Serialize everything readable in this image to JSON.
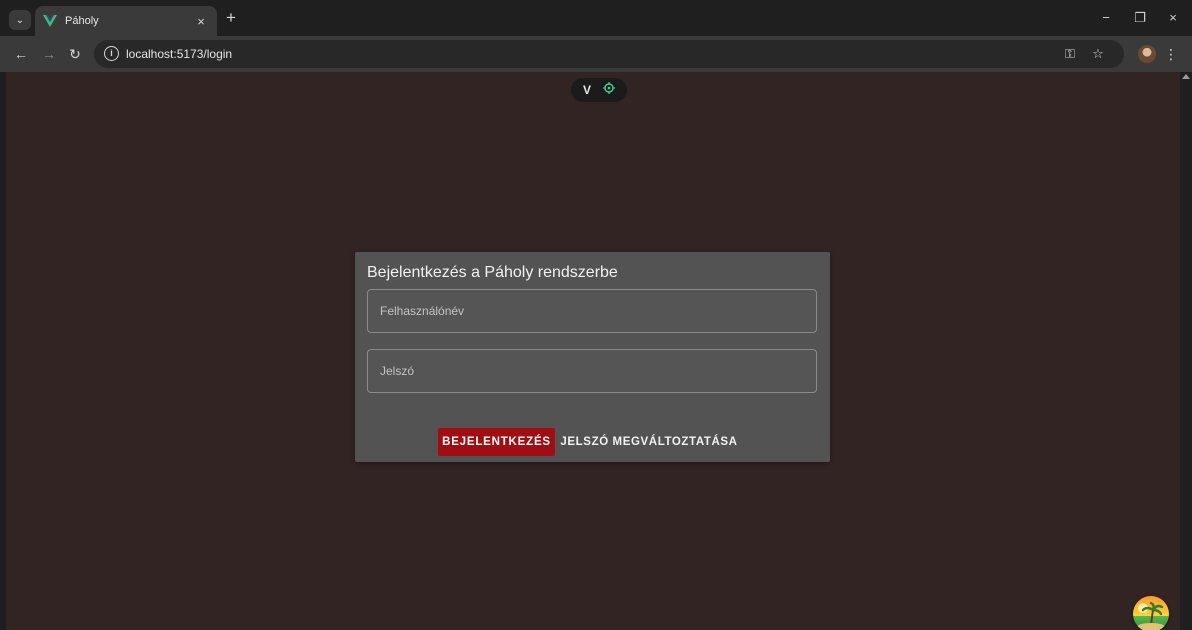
{
  "browser": {
    "tab": {
      "title": "Páholy",
      "close_glyph": "×",
      "favicon": "vue-logo-icon"
    },
    "tab_search_glyph": "⌄",
    "new_tab_glyph": "+",
    "window_controls": {
      "minimize": "−",
      "restore": "❐",
      "close": "×"
    },
    "nav": {
      "back": "←",
      "forward": "→",
      "reload": "↻"
    },
    "address_bar": {
      "url": "localhost:5173/login",
      "site_info_glyph": "i"
    },
    "icons": {
      "password_key": "⚿",
      "bookmark_star": "☆",
      "menu": "⋮"
    }
  },
  "page": {
    "background_color": "#332424",
    "devtools": {
      "logo_glyph": "V",
      "accent_color": "#3fd68a"
    },
    "login": {
      "title": "Bejelentkezés a Páholy rendszerbe",
      "username_placeholder": "Felhasználónév",
      "username_value": "",
      "password_placeholder": "Jelszó",
      "password_value": "",
      "login_button": "BEJELENTKEZÉS",
      "change_password_button": "JELSZÓ MEGVÁLTOZTATÁSA",
      "login_button_color": "#a00e14"
    }
  }
}
